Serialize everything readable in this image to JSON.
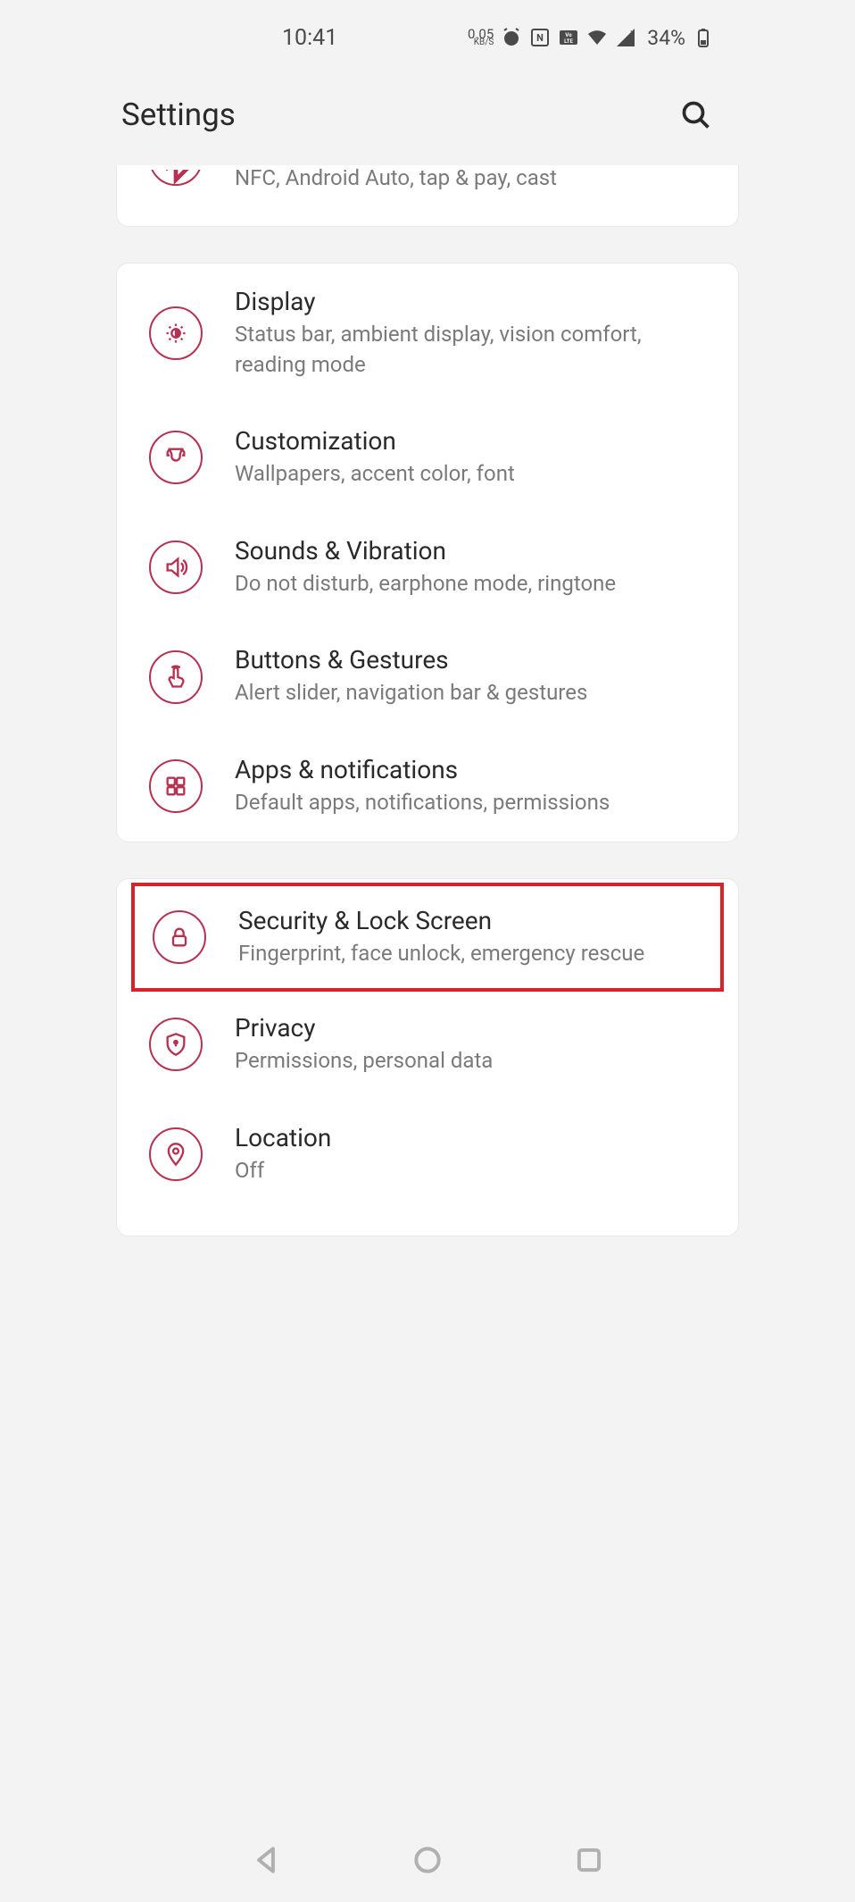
{
  "statusBar": {
    "time": "10:41",
    "kbsSpeed": "0.05",
    "kbsLabel": "KB/S",
    "battery": "34%"
  },
  "header": {
    "title": "Settings"
  },
  "partialRow": {
    "subtitle": "NFC, Android Auto, tap & pay, cast"
  },
  "group1": {
    "display": {
      "title": "Display",
      "subtitle": "Status bar, ambient display, vision comfort, reading mode"
    },
    "customization": {
      "title": "Customization",
      "subtitle": "Wallpapers, accent color, font"
    },
    "sounds": {
      "title": "Sounds & Vibration",
      "subtitle": "Do not disturb, earphone mode, ringtone"
    },
    "buttons": {
      "title": "Buttons & Gestures",
      "subtitle": "Alert slider, navigation bar & gestures"
    },
    "apps": {
      "title": "Apps & notifications",
      "subtitle": "Default apps, notifications, permissions"
    }
  },
  "group2": {
    "security": {
      "title": "Security & Lock Screen",
      "subtitle": "Fingerprint, face unlock, emergency rescue"
    },
    "privacy": {
      "title": "Privacy",
      "subtitle": "Permissions, personal data"
    },
    "location": {
      "title": "Location",
      "subtitle": "Off"
    }
  }
}
